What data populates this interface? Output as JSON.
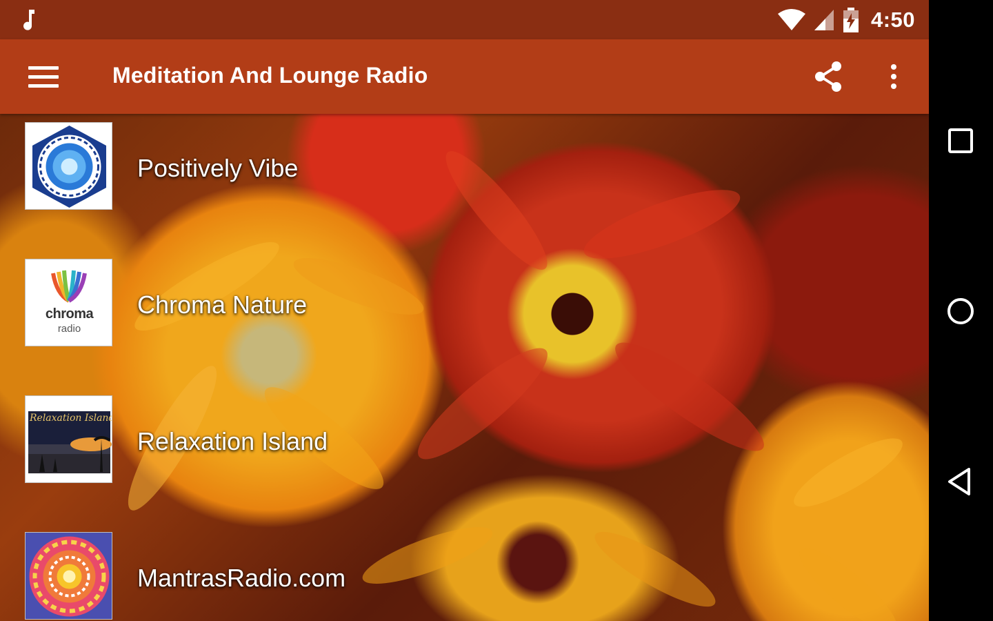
{
  "status_bar": {
    "time": "4:50",
    "icons": [
      "music-note-icon",
      "wifi-icon",
      "signal-icon",
      "battery-charging-icon"
    ]
  },
  "toolbar": {
    "title": "Meditation And Lounge Radio",
    "menu_icon": "hamburger-menu-icon",
    "share_icon": "share-icon",
    "more_icon": "more-vert-icon"
  },
  "stations": [
    {
      "name": "Positively Vibe",
      "logo": "positively-vibe-logo"
    },
    {
      "name": "Chroma Nature",
      "logo": "chroma-radio-logo",
      "logo_text": "chroma",
      "logo_subtext": "radio"
    },
    {
      "name": "Relaxation Island",
      "logo": "relaxation-island-logo",
      "logo_text": "Relaxation Island"
    },
    {
      "name": "MantrasRadio.com",
      "logo": "mantras-radio-logo"
    }
  ],
  "navigation": {
    "recent_icon": "recent-apps-icon",
    "home_icon": "home-icon",
    "back_icon": "back-icon"
  },
  "colors": {
    "status_bar": "#8a2e12",
    "toolbar": "#b23d17",
    "navbar": "#000000"
  }
}
